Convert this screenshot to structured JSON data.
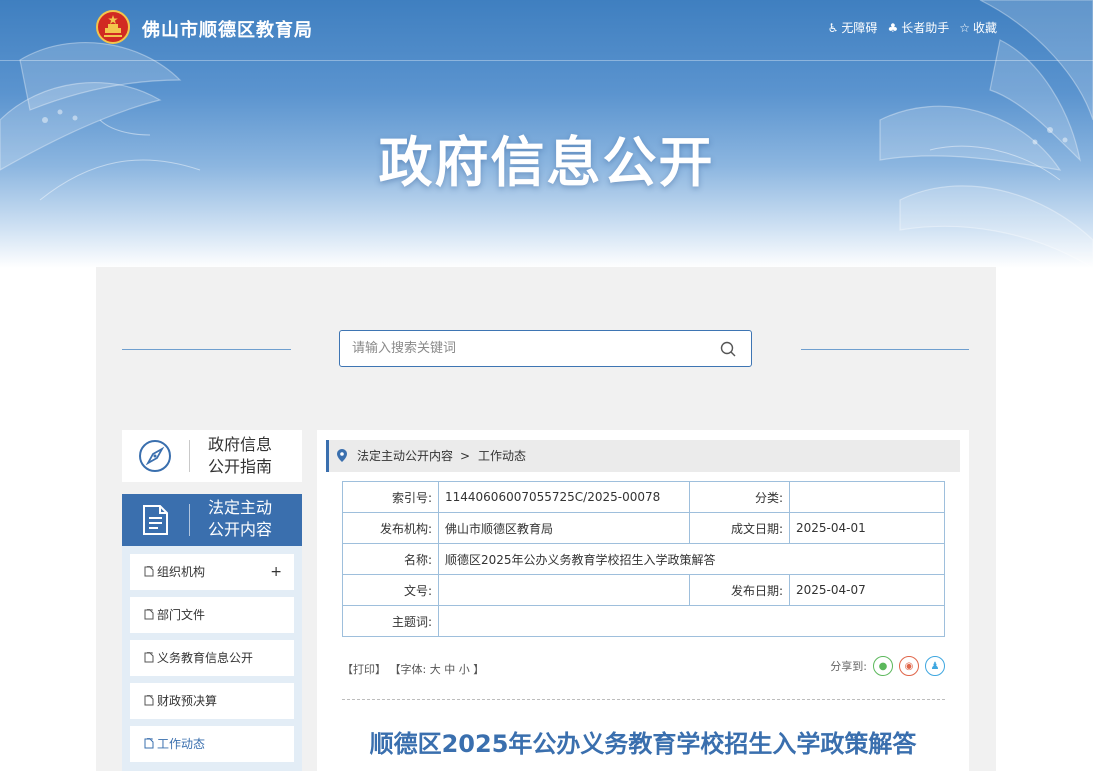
{
  "header": {
    "site_name": "佛山市顺德区教育局",
    "links": [
      {
        "label": "无障碍",
        "icon": "wheelchair-icon"
      },
      {
        "label": "长者助手",
        "icon": "elder-icon"
      },
      {
        "label": "收藏",
        "icon": "star-icon"
      }
    ],
    "hero_title": "政府信息公开"
  },
  "search": {
    "placeholder": "请输入搜索关键词"
  },
  "sidebar": {
    "guide": {
      "line1": "政府信息",
      "line2": "公开指南"
    },
    "active": {
      "line1": "法定主动",
      "line2": "公开内容"
    },
    "items": [
      {
        "label": "组织机构",
        "has_children": true,
        "expand_symbol": "+"
      },
      {
        "label": "部门文件"
      },
      {
        "label": "义务教育信息公开"
      },
      {
        "label": "财政预决算"
      },
      {
        "label": "工作动态"
      }
    ]
  },
  "breadcrumb": {
    "items": [
      "法定主动公开内容",
      "工作动态"
    ],
    "separator": ">"
  },
  "meta": {
    "index_label": "索引号:",
    "index_value": "11440606007055725C/2025-00078",
    "category_label": "分类:",
    "category_value": "",
    "org_label": "发布机构:",
    "org_value": "佛山市顺德区教育局",
    "written_label": "成文日期:",
    "written_value": "2025-04-01",
    "name_label": "名称:",
    "name_value": "顺德区2025年公办义务教育学校招生入学政策解答",
    "docno_label": "文号:",
    "docno_value": "",
    "publish_label": "发布日期:",
    "publish_value": "2025-04-07",
    "subject_label": "主题词:",
    "subject_value": ""
  },
  "tools": {
    "print": "【打印】",
    "font_prefix": "【字体:",
    "font_large": "大",
    "font_medium": "中",
    "font_small": "小",
    "font_suffix": "】",
    "share_label": "分享到:"
  },
  "article": {
    "title": "顺德区2025年公办义务教育学校招生入学政策解答"
  },
  "colors": {
    "primary": "#3a6fae",
    "border": "#9ebfdc",
    "wechat": "#5cb85c",
    "weibo": "#e0664a",
    "qq": "#3fa7e0"
  }
}
